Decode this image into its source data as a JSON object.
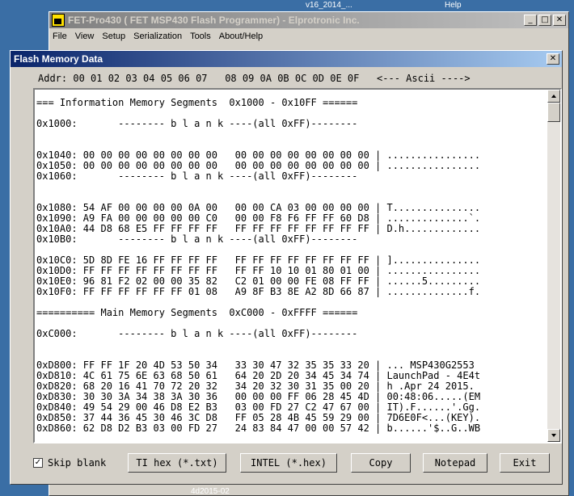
{
  "desktop": {
    "top_text_left": "v16_2014_...",
    "top_text_right": "Help",
    "bottom_text": "4d2015-02"
  },
  "main_window": {
    "title": "FET-Pro430  ( FET MSP430 Flash Programmer)  -  Elprotronic Inc.",
    "menu": [
      "File",
      "View",
      "Setup",
      "Serialization",
      "Tools",
      "About/Help"
    ]
  },
  "dialog": {
    "title": "Flash Memory Data",
    "header": "Addr: 00 01 02 03 04 05 06 07   08 09 0A 0B 0C 0D 0E 0F   <--- Ascii ---->",
    "lines": [
      "=== Information Memory Segments  0x1000 - 0x10FF ======",
      "",
      "0x1000:       -------- b l a n k ----(all 0xFF)--------",
      "",
      "",
      "0x1040: 00 00 00 00 00 00 00 00   00 00 00 00 00 00 00 00 | ................",
      "0x1050: 00 00 00 00 00 00 00 00   00 00 00 00 00 00 00 00 | ................",
      "0x1060:       -------- b l a n k ----(all 0xFF)--------",
      "",
      "",
      "0x1080: 54 AF 00 00 00 00 0A 00   00 00 CA 03 00 00 00 00 | T...............",
      "0x1090: A9 FA 00 00 00 00 00 C0   00 00 F8 F6 FF FF 60 D8 | ..............`.",
      "0x10A0: 44 D8 68 E5 FF FF FF FF   FF FF FF FF FF FF FF FF | D.h.............",
      "0x10B0:       -------- b l a n k ----(all 0xFF)--------",
      "",
      "0x10C0: 5D 8D FE 16 FF FF FF FF   FF FF FF FF FF FF FF FF | ]...............",
      "0x10D0: FF FF FF FF FF FF FF FF   FF FF 10 10 01 80 01 00 | ................",
      "0x10E0: 96 81 F2 02 00 00 35 82   C2 01 00 00 FE 08 FF FF | ......5.........",
      "0x10F0: FF FF FF FF FF FF 01 08   A9 8F B3 8E A2 8D 66 87 | ..............f.",
      "",
      "========== Main Memory Segments  0xC000 - 0xFFFF ======",
      "",
      "0xC000:       -------- b l a n k ----(all 0xFF)--------",
      "",
      "",
      "0xD800: FF FF 1F 20 4D 53 50 34   33 30 47 32 35 35 33 20 | ... MSP430G2553",
      "0xD810: 4C 61 75 6E 63 68 50 61   64 20 2D 20 34 45 34 74 | LaunchPad - 4E4t",
      "0xD820: 68 20 16 41 70 72 20 32   34 20 32 30 31 35 00 20 | h .Apr 24 2015.",
      "0xD830: 30 30 3A 34 38 3A 30 36   00 00 00 FF 06 28 45 4D | 00:48:06.....(EM",
      "0xD840: 49 54 29 00 46 D8 E2 B3   03 00 FD 27 C2 47 67 00 | IT).F......'.Gg.",
      "0xD850: 37 44 36 45 30 46 3C D8   FF 05 28 4B 45 59 29 00 | 7D6E0F<...(KEY).",
      "0xD860: 62 D8 D2 B3 03 00 FD 27   24 83 84 47 00 00 57 42 | b......'$..G..WB"
    ],
    "skip_blank_label": "Skip blank",
    "buttons": {
      "ti_hex": "TI hex (*.txt)",
      "intel_hex": "INTEL (*.hex)",
      "copy": "Copy",
      "notepad": "Notepad",
      "exit": "Exit"
    }
  },
  "controls": {
    "minimize": "_",
    "maximize": "□",
    "close": "✕",
    "check": "✓"
  },
  "colors": {
    "desktop": "#3a6ea5",
    "face": "#d4d0c8",
    "title_active": "#0a246a"
  }
}
